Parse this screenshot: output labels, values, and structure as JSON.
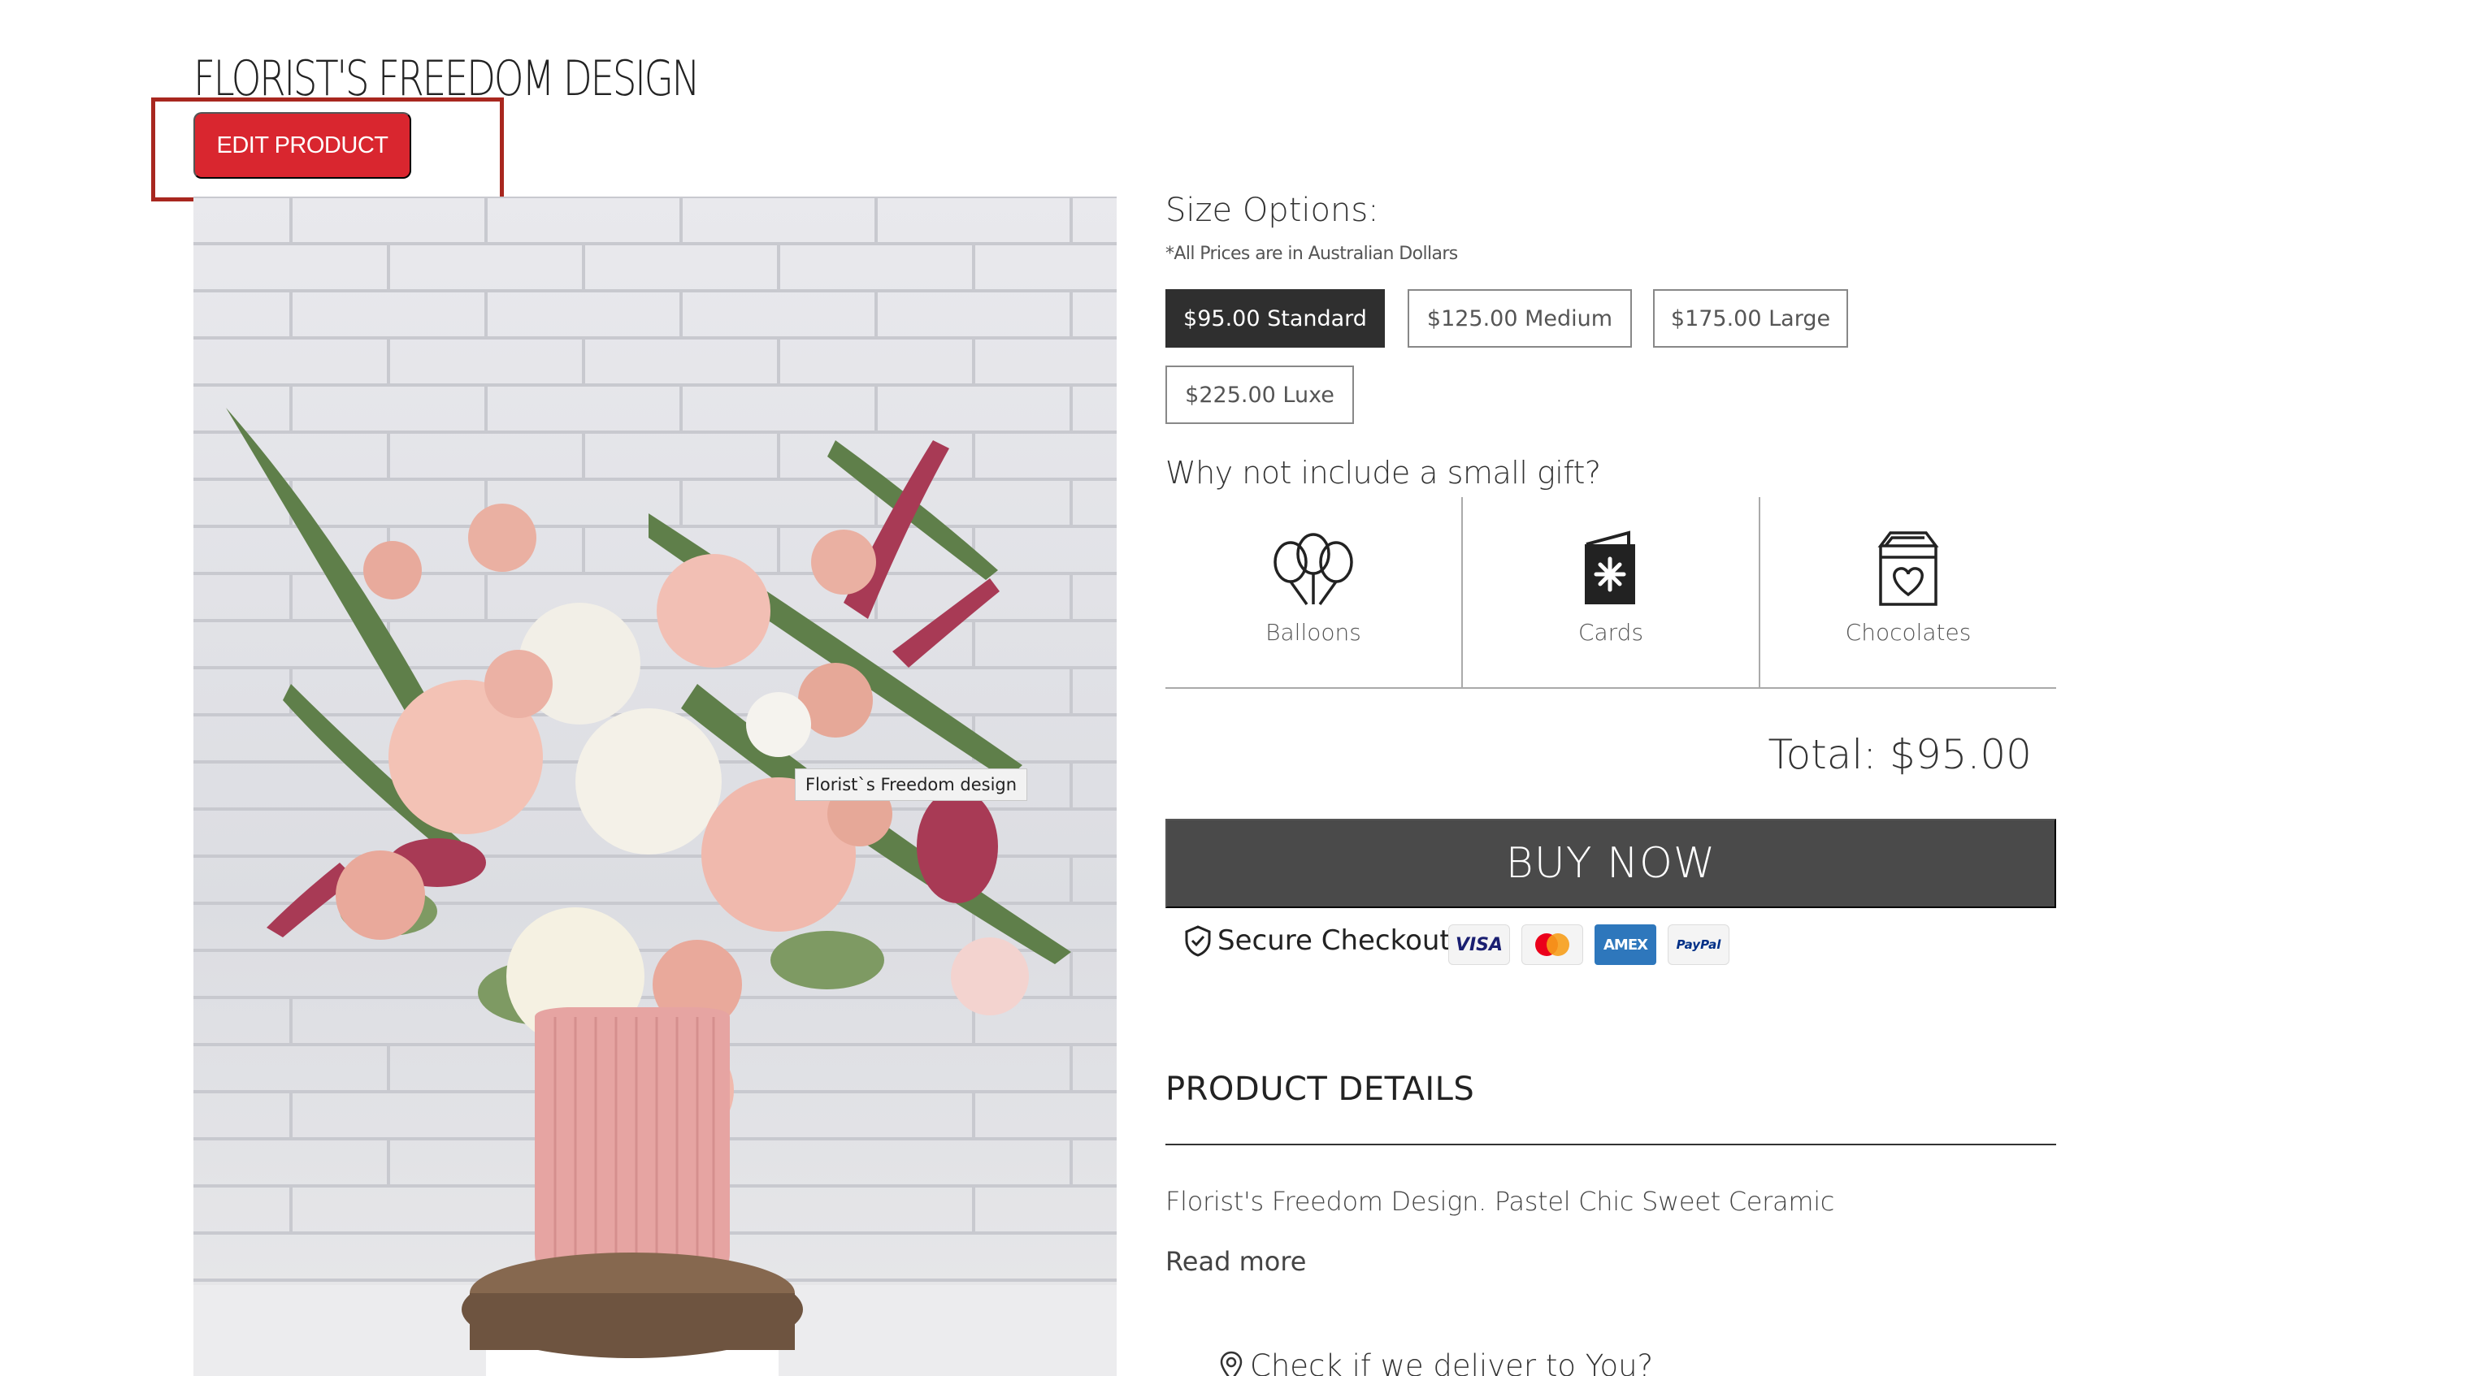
{
  "product": {
    "title": "FLORIST'S FREEDOM DESIGN",
    "edit_label": "EDIT PRODUCT",
    "image_tooltip": "Florist`s Freedom design"
  },
  "sizes": {
    "heading": "Size Options:",
    "note": "*All Prices are in Australian Dollars",
    "options": [
      {
        "label": "$95.00 Standard",
        "selected": true
      },
      {
        "label": "$125.00 Medium",
        "selected": false
      },
      {
        "label": "$175.00 Large",
        "selected": false
      },
      {
        "label": "$225.00 Luxe",
        "selected": false
      }
    ]
  },
  "gifts": {
    "heading": "Why not include a small gift?",
    "items": [
      {
        "label": "Balloons",
        "icon": "balloons-icon"
      },
      {
        "label": "Cards",
        "icon": "card-icon"
      },
      {
        "label": "Chocolates",
        "icon": "chocolates-icon"
      }
    ]
  },
  "total": "Total: $95.00",
  "buy_label": "BUY NOW",
  "secure_label": "Secure Checkout",
  "payment_methods": [
    "VISA",
    "Mastercard",
    "AMEX",
    "PayPal"
  ],
  "details": {
    "heading": "PRODUCT DETAILS",
    "text": "Florist's Freedom Design. Pastel Chic Sweet Ceramic",
    "read_more": "Read more"
  },
  "deliver_label": "Check if we deliver to You?",
  "colors": {
    "edit_button": "#d9262f",
    "highlight_box": "#a8271f",
    "selected_size": "#2f2f2f",
    "buy_button": "#4a4a4a"
  }
}
